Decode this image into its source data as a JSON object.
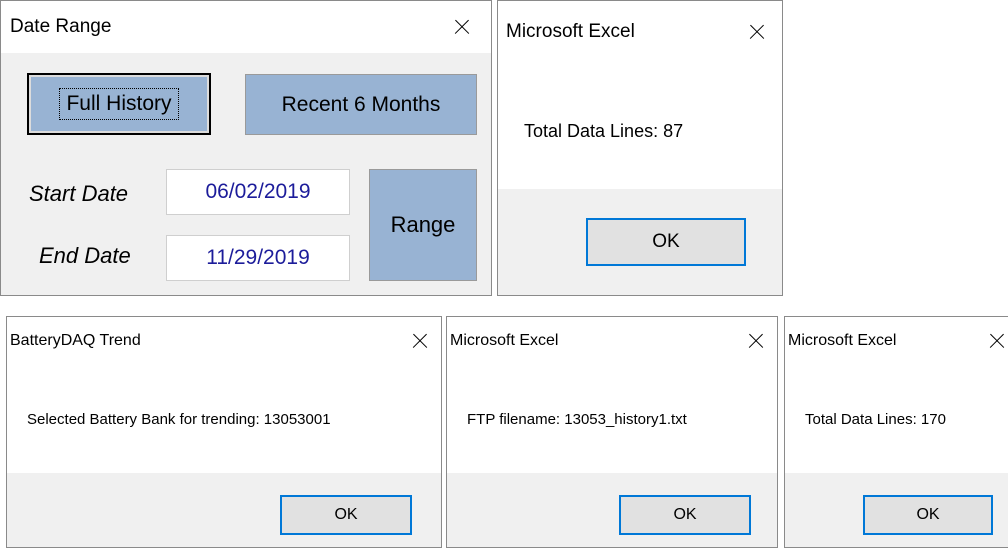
{
  "date_range": {
    "title": "Date Range",
    "full_history_label": "Full History",
    "recent_6_months_label": "Recent 6 Months",
    "start_date_label": "Start Date",
    "start_date_value": "06/02/2019",
    "end_date_label": "End Date",
    "end_date_value": "11/29/2019",
    "range_label": "Range",
    "accent_color": "#98b3d3",
    "date_text_color": "#1c1c9a"
  },
  "excel_total_87": {
    "title": "Microsoft Excel",
    "message": "Total Data Lines: 87",
    "ok_label": "OK"
  },
  "battery_trend": {
    "title": "BatteryDAQ Trend",
    "message": "Selected Battery Bank for trending: 13053001",
    "ok_label": "OK"
  },
  "excel_ftp": {
    "title": "Microsoft Excel",
    "message": "FTP filename: 13053_history1.txt",
    "ok_label": "OK"
  },
  "excel_total_170": {
    "title": "Microsoft Excel",
    "message": "Total Data Lines: 170",
    "ok_label": "OK"
  },
  "icons": {
    "close": "close-icon"
  }
}
